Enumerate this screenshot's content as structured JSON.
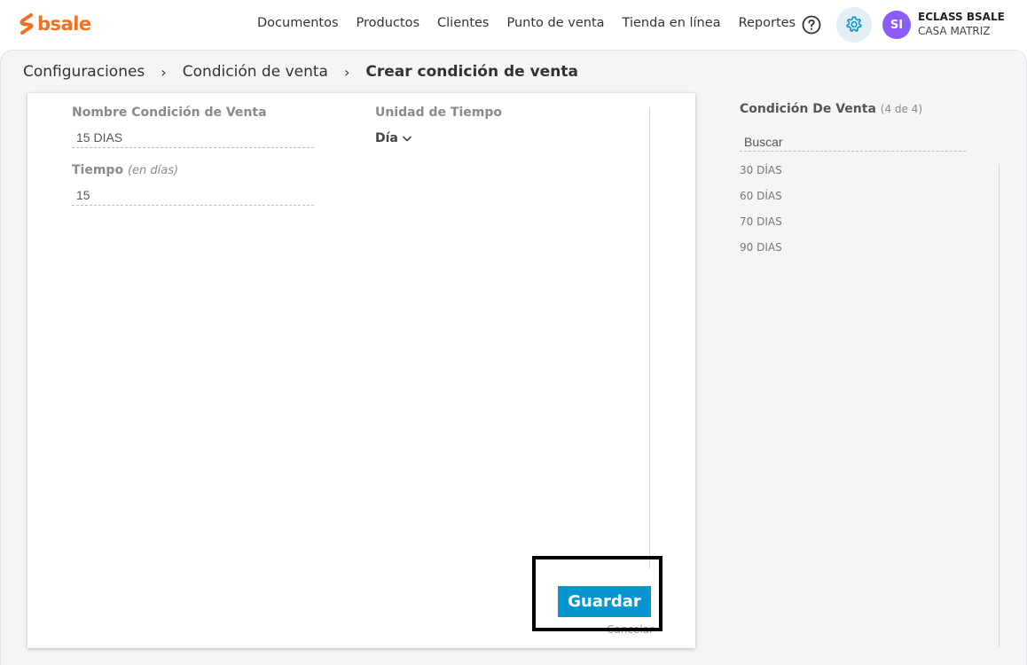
{
  "brand": {
    "name": "bsale",
    "accent": "#f4701f"
  },
  "nav": {
    "items": [
      {
        "label": "Documentos"
      },
      {
        "label": "Productos"
      },
      {
        "label": "Clientes"
      },
      {
        "label": "Punto de venta"
      },
      {
        "label": "Tienda en línea"
      },
      {
        "label": "Reportes"
      }
    ]
  },
  "user": {
    "initials": "SI",
    "name": "ECLASS BSALE",
    "branch": "CASA MATRIZ",
    "avatar_color": "#8b5cf6"
  },
  "breadcrumb": {
    "items": [
      {
        "label": "Configuraciones"
      },
      {
        "label": "Condición de venta"
      }
    ],
    "current": "Crear condición de venta"
  },
  "form": {
    "name_label": "Nombre Condición de Venta",
    "name_value": "15 DIAS",
    "unit_label": "Unidad de Tiempo",
    "unit_value": "Día",
    "time_label": "Tiempo",
    "time_hint": "(en días)",
    "time_value": "15",
    "save_label": "Guardar",
    "cancel_label": "Cancelar",
    "primary_color": "#0596cf"
  },
  "side": {
    "title": "Condición De Venta",
    "count": "(4 de 4)",
    "search_placeholder": "Buscar",
    "items": [
      {
        "label": "30 DÍAS"
      },
      {
        "label": "60 DÍAS"
      },
      {
        "label": "70 DIAS"
      },
      {
        "label": "90 DIAS"
      }
    ]
  }
}
